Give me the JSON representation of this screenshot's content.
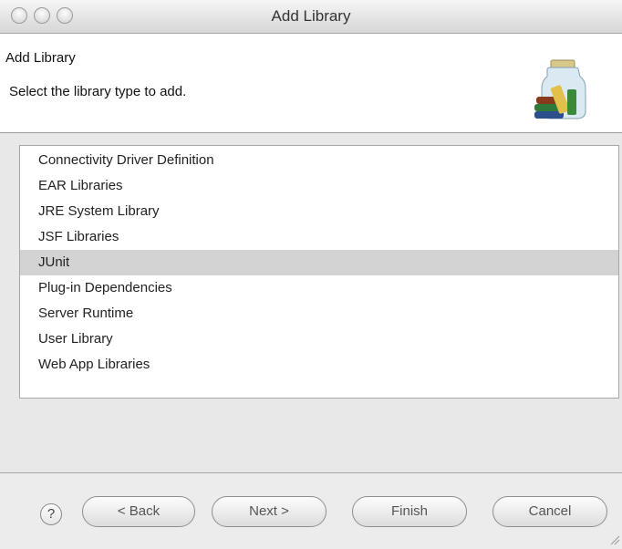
{
  "window": {
    "title": "Add Library"
  },
  "header": {
    "title": "Add Library",
    "subtitle": "Select the library type to add."
  },
  "library_types": [
    {
      "label": "Connectivity Driver Definition",
      "selected": false
    },
    {
      "label": "EAR Libraries",
      "selected": false
    },
    {
      "label": "JRE System Library",
      "selected": false
    },
    {
      "label": "JSF Libraries",
      "selected": false
    },
    {
      "label": "JUnit",
      "selected": true
    },
    {
      "label": "Plug-in Dependencies",
      "selected": false
    },
    {
      "label": "Server Runtime",
      "selected": false
    },
    {
      "label": "User Library",
      "selected": false
    },
    {
      "label": "Web App Libraries",
      "selected": false
    }
  ],
  "footer": {
    "help_label": "?",
    "back_label": "< Back",
    "next_label": "Next >",
    "finish_label": "Finish",
    "cancel_label": "Cancel"
  },
  "colors": {
    "selection": "#d3d3d3",
    "dialog_background": "#e8e8e8"
  }
}
